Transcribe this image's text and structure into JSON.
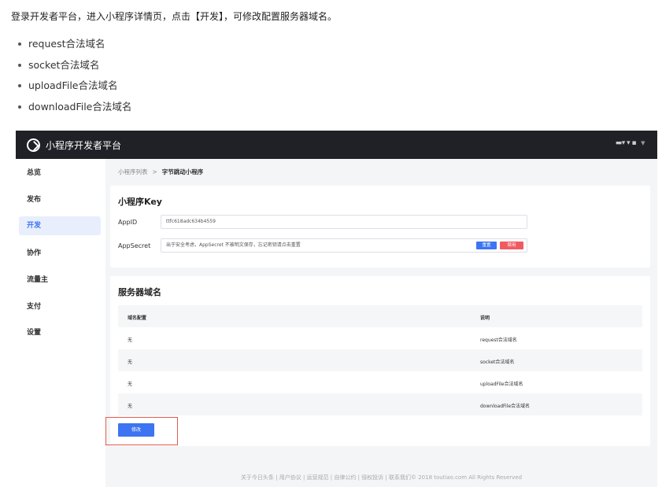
{
  "intro": "登录开发者平台，进入小程序详情页，点击【开发】，可修改配置服务器域名。",
  "bullets": [
    "request合法域名",
    "socket合法域名",
    "uploadFile合法域名",
    "downloadFile合法域名"
  ],
  "app": {
    "brand": "小程序开发者平台",
    "user_menu": "▬▾ ▾ ▪",
    "sidebar": {
      "items": [
        {
          "label": "总览",
          "active": false
        },
        {
          "label": "发布",
          "active": false
        },
        {
          "label": "开发",
          "active": true
        },
        {
          "label": "协作",
          "active": false
        },
        {
          "label": "流量主",
          "active": false
        },
        {
          "label": "支付",
          "active": false
        },
        {
          "label": "设置",
          "active": false
        }
      ]
    },
    "breadcrumb": {
      "parent": "小程序列表",
      "separator": ">",
      "current": "字节跳动小程序"
    },
    "key_card": {
      "title": "小程序Key",
      "appid_label": "AppID",
      "appid_value": "ttfc618adc634b4559",
      "appsecret_label": "AppSecret",
      "appsecret_value": "出于安全考虑，AppSecret 不被明文保存，忘记密钥请点击重置",
      "reset_button": "重置",
      "disable_button": "禁用"
    },
    "domain_card": {
      "title": "服务器域名",
      "columns": [
        "域名配置",
        "说明"
      ],
      "rows": [
        {
          "config": "无",
          "desc": "request合法域名"
        },
        {
          "config": "无",
          "desc": "socket合法域名"
        },
        {
          "config": "无",
          "desc": "uploadFile合法域名"
        },
        {
          "config": "无",
          "desc": "downloadFile合法域名"
        }
      ],
      "modify_button": "修改"
    },
    "footer": "关于今日头条 | 用户协议 | 运营规范 | 自律公约 | 侵权投诉 | 联系我们© 2018 toutiao.com All Rights Reserved"
  },
  "colors": {
    "accent": "#3d74f2",
    "danger": "#f05b62",
    "topbar": "#1f2126",
    "highlight": "#e25c4f"
  }
}
